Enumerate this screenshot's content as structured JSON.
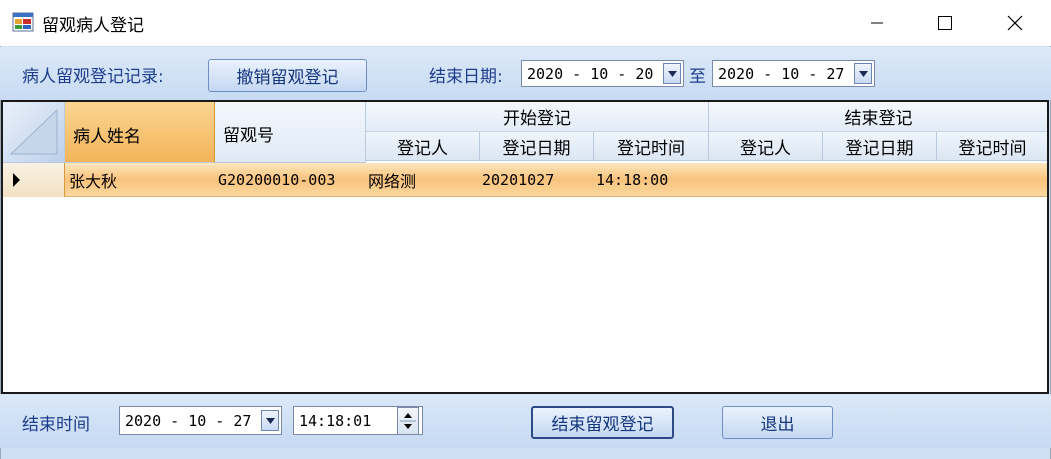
{
  "window": {
    "title": "留观病人登记",
    "icon": "app-form-icon",
    "controls": [
      "minimize-icon",
      "maximize-icon",
      "close-icon"
    ]
  },
  "toolbar": {
    "records_label": "病人留观登记记录:",
    "cancel_button": "撤销留观登记",
    "end_date_label": "结束日期:",
    "date_from": "2020 - 10 - 20",
    "to_label": "至",
    "date_to": "2020 - 10 - 27"
  },
  "grid": {
    "columns": {
      "patient_name": "病人姓名",
      "observation_no": "留观号",
      "start_group": "开始登记",
      "end_group": "结束登记",
      "start_registrar": "登记人",
      "start_date": "登记日期",
      "start_time": "登记时间",
      "end_registrar": "登记人",
      "end_date": "登记日期",
      "end_time": "登记时间"
    },
    "rows": [
      {
        "patient_name": "张大秋",
        "observation_no": "G20200010-003",
        "start_registrar": "网络测",
        "start_date": "20201027",
        "start_time": "14:18:00",
        "end_registrar": "",
        "end_date": "",
        "end_time": ""
      }
    ]
  },
  "bottom": {
    "end_time_label": "结束时间",
    "end_date": "2020 - 10 - 27",
    "end_time": "14:18:01",
    "finish_button": "结束留观登记",
    "exit_button": "退出"
  },
  "colors": {
    "selected_row": "#f9c27c",
    "toolbar_bg": "#cfe0f5",
    "label_text": "#1e3d8c"
  }
}
